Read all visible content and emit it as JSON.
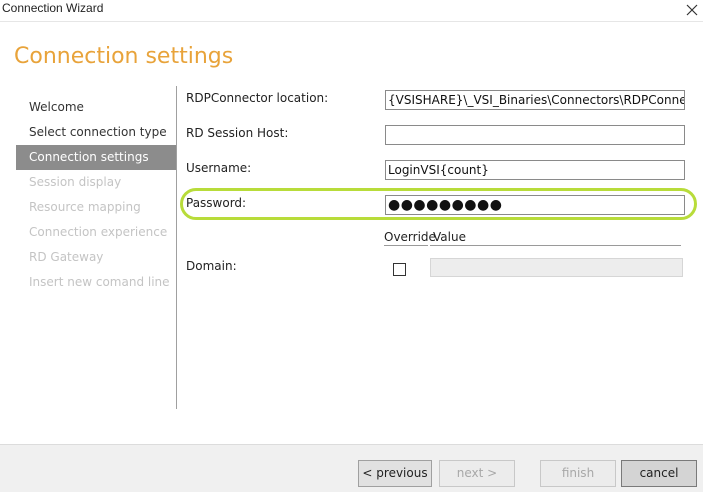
{
  "window": {
    "title": "Connection Wizard",
    "close_icon": "close-icon"
  },
  "header": {
    "title": "Connection settings",
    "title_color": "#e8a33a"
  },
  "sidebar": {
    "items": [
      {
        "label": "Welcome",
        "state": "normal"
      },
      {
        "label": "Select connection type",
        "state": "normal"
      },
      {
        "label": "Connection settings",
        "state": "active"
      },
      {
        "label": "Session display",
        "state": "disabled"
      },
      {
        "label": "Resource mapping",
        "state": "disabled"
      },
      {
        "label": "Connection experience",
        "state": "disabled"
      },
      {
        "label": "RD Gateway",
        "state": "disabled"
      },
      {
        "label": "Insert new comand line",
        "state": "disabled"
      }
    ]
  },
  "form": {
    "rdpconnector": {
      "label": "RDPConnector location:",
      "value": "{VSISHARE}\\_VSI_Binaries\\Connectors\\RDPConnect.exe"
    },
    "rd_session_host": {
      "label": "RD Session Host:",
      "value": ""
    },
    "username": {
      "label": "Username:",
      "value": "LoginVSI{count}"
    },
    "password": {
      "label": "Password:",
      "value": "●●●●●●●●●"
    },
    "override_header": "Override",
    "value_header": "Value",
    "domain": {
      "label": "Domain:",
      "override_checked": false,
      "value": ""
    },
    "highlight_color": "#b8dc3a"
  },
  "footer": {
    "previous_label": "< previous",
    "next_label": "next >",
    "finish_label": "finish",
    "cancel_label": "cancel"
  }
}
